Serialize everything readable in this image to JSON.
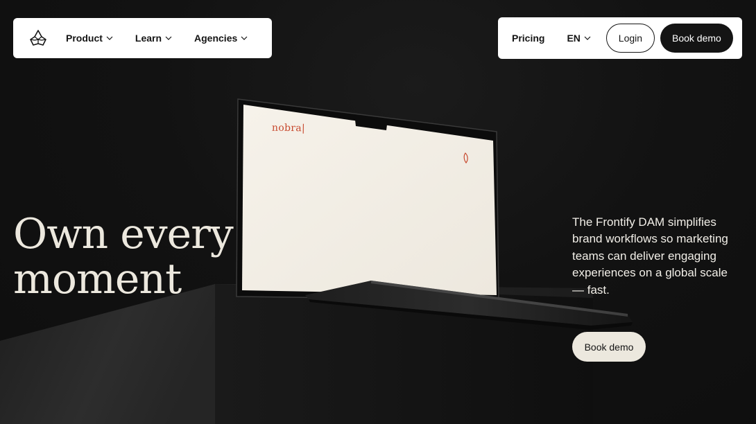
{
  "colors": {
    "background": "#111111",
    "nav_bg": "#ffffff",
    "text_dark": "#141414",
    "headline": "#ece8de",
    "accent_screen_logo": "#c7472c",
    "hero_button_bg": "#ece8de"
  },
  "nav": {
    "logo_icon": "frontify-logo-icon",
    "items": [
      {
        "label": "Product",
        "icon": "chevron-down-icon"
      },
      {
        "label": "Learn",
        "icon": "chevron-down-icon"
      },
      {
        "label": "Agencies",
        "icon": "chevron-down-icon"
      }
    ],
    "pricing": "Pricing",
    "language": "EN",
    "login": "Login",
    "book_demo": "Book demo"
  },
  "hero": {
    "headline_line1": "Own every",
    "headline_line2": "moment",
    "description": "The Frontify DAM simplifies brand workflows so marketing teams can deliver engaging experiences on a global scale — fast.",
    "cta": "Book demo",
    "screen_logo": "nobra|"
  }
}
